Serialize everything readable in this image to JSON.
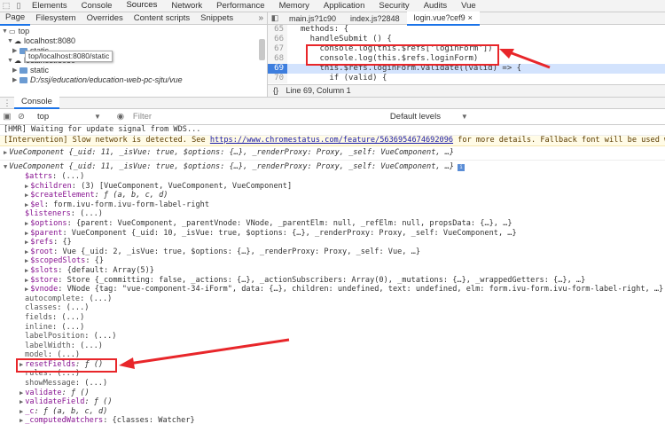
{
  "tabbar": {
    "tabs": [
      "Elements",
      "Console",
      "Sources",
      "Network",
      "Performance",
      "Memory",
      "Application",
      "Security",
      "Audits",
      "Vue"
    ],
    "active": "Sources"
  },
  "navigator": {
    "tabs": [
      "Page",
      "Filesystem",
      "Overrides",
      "Content scripts",
      "Snippets"
    ],
    "tree": {
      "top": "top",
      "host1": "localhost:8080",
      "static1": "static",
      "host2": "localhost:8080",
      "static2": "static",
      "path": "D:/ssj/education/education-web-pc-sjtu/vue"
    },
    "tooltip": "top/localhost:8080/static"
  },
  "editor": {
    "files": [
      "main.js?1c90",
      "index.js?2848",
      "login.vue?cef9"
    ],
    "active_file": "login.vue?cef9",
    "lines": [
      {
        "n": "65",
        "text": "  methods: {"
      },
      {
        "n": "66",
        "text": "    handleSubmit () {"
      },
      {
        "n": "67",
        "text": "      console.log(this.$refs['loginForm'])"
      },
      {
        "n": "68",
        "text": "      console.log(this.$refs.loginForm)"
      },
      {
        "n": "69",
        "text": "      this.$refs.loginForm.validate((valid) => {"
      },
      {
        "n": "70",
        "text": "        if (valid) {"
      }
    ],
    "status": "Line 69, Column 1"
  },
  "drawer": {
    "tab": "Console",
    "context": "top",
    "filter_placeholder": "Filter",
    "levels": "Default levels"
  },
  "console": {
    "hmr": "[HMR] Waiting for update signal from WDS...",
    "intervention_prefix": "[Intervention] Slow network is detected. See ",
    "intervention_link": "https://www.chromestatus.com/feature/5636954674692096",
    "intervention_suffix": " for more details. Fallback font will be used whil",
    "vc1": "VueComponent {_uid: 11, _isVue: true, $options: {…}, _renderProxy: Proxy, _self: VueComponent, …}",
    "vc2": "VueComponent {_uid: 11, _isVue: true, $options: {…}, _renderProxy: Proxy, _self: VueComponent, …}",
    "props": [
      {
        "k": "$attrs",
        "v": ": (...)"
      },
      {
        "k": "$children",
        "v": ": (3) [VueComponent, VueComponent, VueComponent]"
      },
      {
        "k": "$createElement",
        "v": ": ƒ (a, b, c, d)"
      },
      {
        "k": "$el",
        "v": ": form.ivu-form.ivu-form-label-right"
      },
      {
        "k": "$listeners",
        "v": ": (...)"
      },
      {
        "k": "$options",
        "v": ": {parent: VueComponent, _parentVnode: VNode, _parentElm: null, _refElm: null, propsData: {…}, …}"
      },
      {
        "k": "$parent",
        "v": ": VueComponent {_uid: 10, _isVue: true, $options: {…}, _renderProxy: Proxy, _self: VueComponent, …}"
      },
      {
        "k": "$refs",
        "v": ": {}"
      },
      {
        "k": "$root",
        "v": ": Vue {_uid: 2, _isVue: true, $options: {…}, _renderProxy: Proxy, _self: Vue, …}"
      },
      {
        "k": "$scopedSlots",
        "v": ": {}"
      },
      {
        "k": "$slots",
        "v": ": {default: Array(5)}"
      },
      {
        "k": "$store",
        "v": ": Store {_committing: false, _actions: {…}, _actionSubscribers: Array(0), _mutations: {…}, _wrappedGetters: {…}, …}"
      },
      {
        "k": "$vnode",
        "v": ": VNode {tag: \"vue-component-34-iForm\", data: {…}, children: undefined, text: undefined, elm: form.ivu-form.ivu-form-label-right, …}"
      },
      {
        "k": "autocomplete",
        "v": ": (...)"
      },
      {
        "k": "classes",
        "v": ": (...)"
      },
      {
        "k": "fields",
        "v": ": (...)"
      },
      {
        "k": "inline",
        "v": ": (...)"
      },
      {
        "k": "labelPosition",
        "v": ": (...)"
      },
      {
        "k": "labelWidth",
        "v": ": (...)"
      },
      {
        "k": "model",
        "v": ": (...)"
      },
      {
        "k": "resetFields",
        "v": ": ƒ ()"
      },
      {
        "k": "rules",
        "v": ": (...)"
      },
      {
        "k": "showMessage",
        "v": ": (...)"
      },
      {
        "k": "validate",
        "v": ": ƒ ()"
      },
      {
        "k": "validateField",
        "v": ": ƒ ()"
      },
      {
        "k": "_c",
        "v": ": ƒ (a, b, c, d)"
      },
      {
        "k": "_computedWatchers",
        "v": ": {classes: Watcher}"
      }
    ]
  },
  "colors": {
    "annotation_red": "#e8262a",
    "highlight_line": "#d3e3fd",
    "accent": "#1a73e8"
  }
}
